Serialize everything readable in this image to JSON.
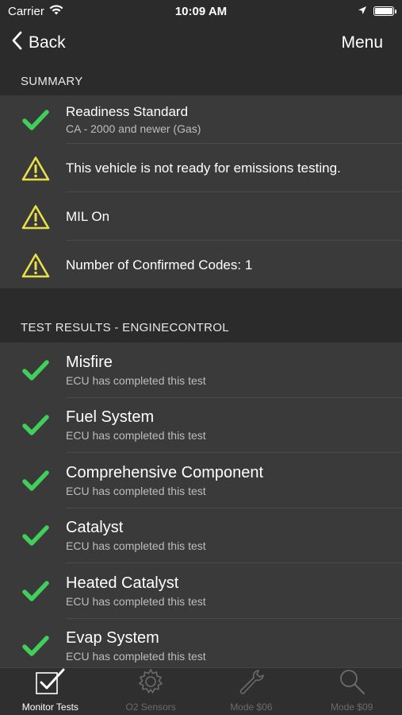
{
  "status_bar": {
    "carrier": "Carrier",
    "time": "10:09 AM"
  },
  "nav": {
    "back_label": "Back",
    "menu_label": "Menu"
  },
  "summary": {
    "header": "SUMMARY",
    "items": [
      {
        "icon": "check-icon",
        "title": "Readiness Standard",
        "subtitle": "CA - 2000 and newer (Gas)"
      },
      {
        "icon": "warning-icon",
        "title": "This vehicle is not ready for emissions testing."
      },
      {
        "icon": "warning-icon",
        "title": "MIL On"
      },
      {
        "icon": "warning-icon",
        "title": "Number of Confirmed Codes: 1"
      }
    ]
  },
  "tests": {
    "header": "TEST RESULTS - ENGINECONTROL",
    "items": [
      {
        "icon": "check-icon",
        "title": "Misfire",
        "subtitle": "ECU has completed this test"
      },
      {
        "icon": "check-icon",
        "title": "Fuel System",
        "subtitle": "ECU has completed this test"
      },
      {
        "icon": "check-icon",
        "title": "Comprehensive Component",
        "subtitle": "ECU has completed this test"
      },
      {
        "icon": "check-icon",
        "title": "Catalyst",
        "subtitle": "ECU has completed this test"
      },
      {
        "icon": "check-icon",
        "title": "Heated Catalyst",
        "subtitle": "ECU has completed this test"
      },
      {
        "icon": "check-icon",
        "title": "Evap System",
        "subtitle": "ECU has completed this test"
      }
    ]
  },
  "tab_bar": {
    "tabs": [
      {
        "label": "Monitor Tests",
        "icon": "checkbox-icon",
        "active": true
      },
      {
        "label": "O2 Sensors",
        "icon": "gear-icon",
        "active": false
      },
      {
        "label": "Mode $06",
        "icon": "wrench-icon",
        "active": false
      },
      {
        "label": "Mode $09",
        "icon": "search-icon",
        "active": false
      }
    ]
  },
  "colors": {
    "check": "#3fcf5a",
    "warning": "#e8e04a",
    "background": "#3a3a3a",
    "header_bg": "#2b2b2b"
  }
}
